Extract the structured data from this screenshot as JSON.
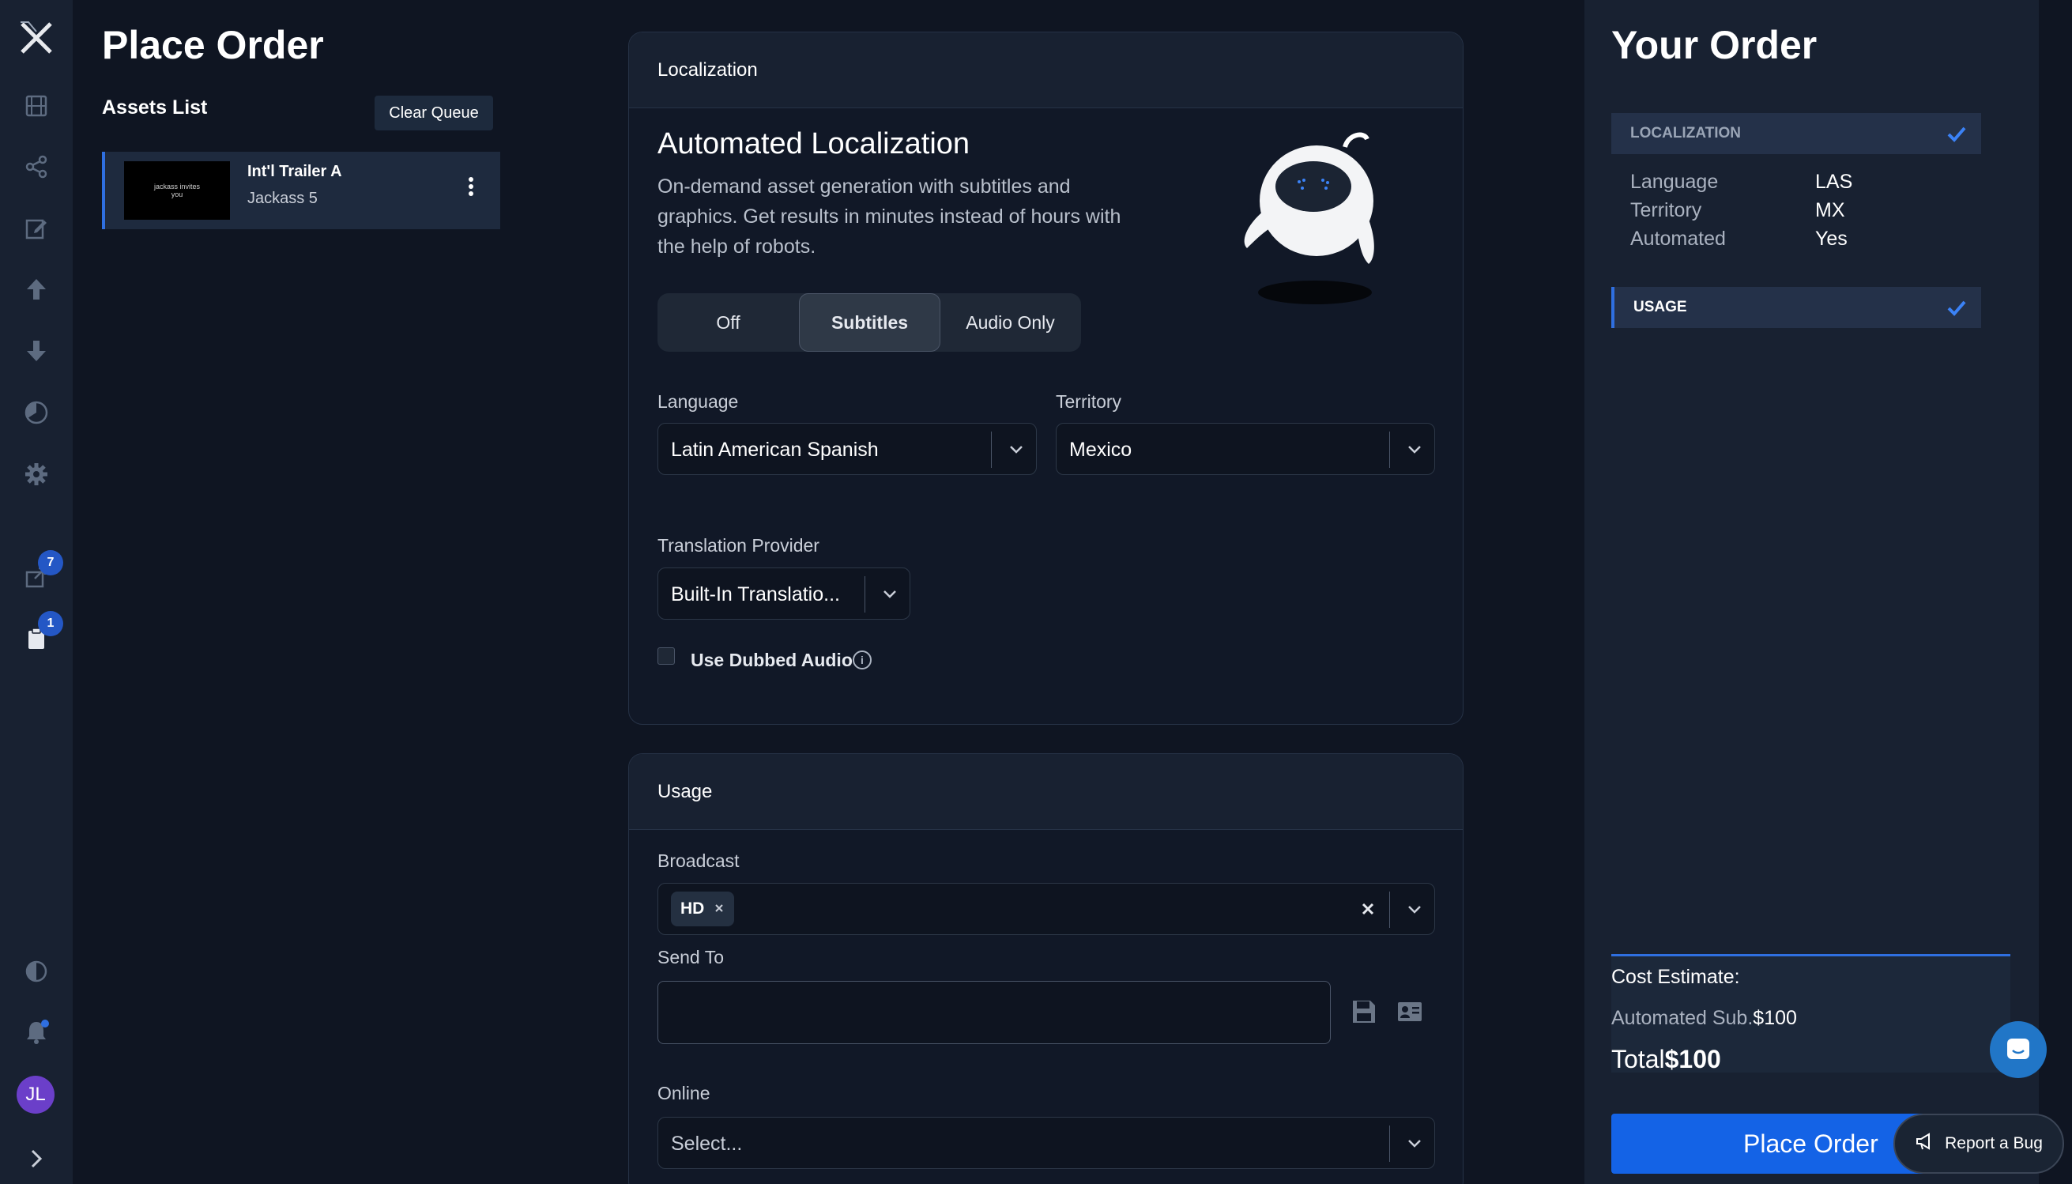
{
  "nav": {
    "logo": "X",
    "icons": [
      "film-icon",
      "share-icon",
      "edit-icon",
      "upload-icon",
      "download-icon",
      "pie-chart-icon",
      "gear-icon",
      "export-icon",
      "clipboard-icon",
      "contrast-icon",
      "bell-icon",
      "expand-icon"
    ],
    "export_badge": "7",
    "queue_badge": "1",
    "avatar_initials": "JL"
  },
  "page": {
    "title": "Place Order"
  },
  "assets": {
    "title": "Assets List",
    "clear_label": "Clear Queue",
    "items": [
      {
        "name": "Int'l Trailer A",
        "title": "Jackass 5",
        "thumb_text": "jackass invites you"
      }
    ]
  },
  "localization": {
    "panel_title": "Localization",
    "heading": "Automated Localization",
    "description": "On-demand asset generation with subtitles and graphics. Get results in minutes instead of hours with the help of robots.",
    "modes": [
      "Off",
      "Subtitles",
      "Audio Only"
    ],
    "selected_mode": "Subtitles",
    "language_label": "Language",
    "language_value": "Latin American Spanish",
    "territory_label": "Territory",
    "territory_value": "Mexico",
    "provider_label": "Translation Provider",
    "provider_value": "Built-In Translatio...",
    "dubbed_label": "Use Dubbed Audio",
    "dubbed_checked": false
  },
  "usage": {
    "panel_title": "Usage",
    "broadcast_label": "Broadcast",
    "broadcast_tags": [
      "HD"
    ],
    "send_to_label": "Send To",
    "send_to_value": "",
    "online_label": "Online",
    "online_placeholder": "Select..."
  },
  "summary": {
    "title": "Your Order",
    "sections": [
      {
        "label": "LOCALIZATION",
        "complete": true
      },
      {
        "label": "USAGE",
        "complete": true
      }
    ],
    "details": [
      {
        "key": "Language",
        "value": "LAS"
      },
      {
        "key": "Territory",
        "value": "MX"
      },
      {
        "key": "Automated",
        "value": "Yes"
      }
    ],
    "cost_label": "Cost Estimate:",
    "line_item_label": "Automated Sub.",
    "line_item_value": "$100",
    "total_label": "Total",
    "total_value": "$100",
    "place_order_label": "Place Order",
    "report_bug_label": "Report a Bug"
  },
  "colors": {
    "accent": "#1463e6",
    "background": "#0f1522",
    "panel": "#182131",
    "badge": "#2457c5",
    "avatar": "#6b3fc9"
  }
}
